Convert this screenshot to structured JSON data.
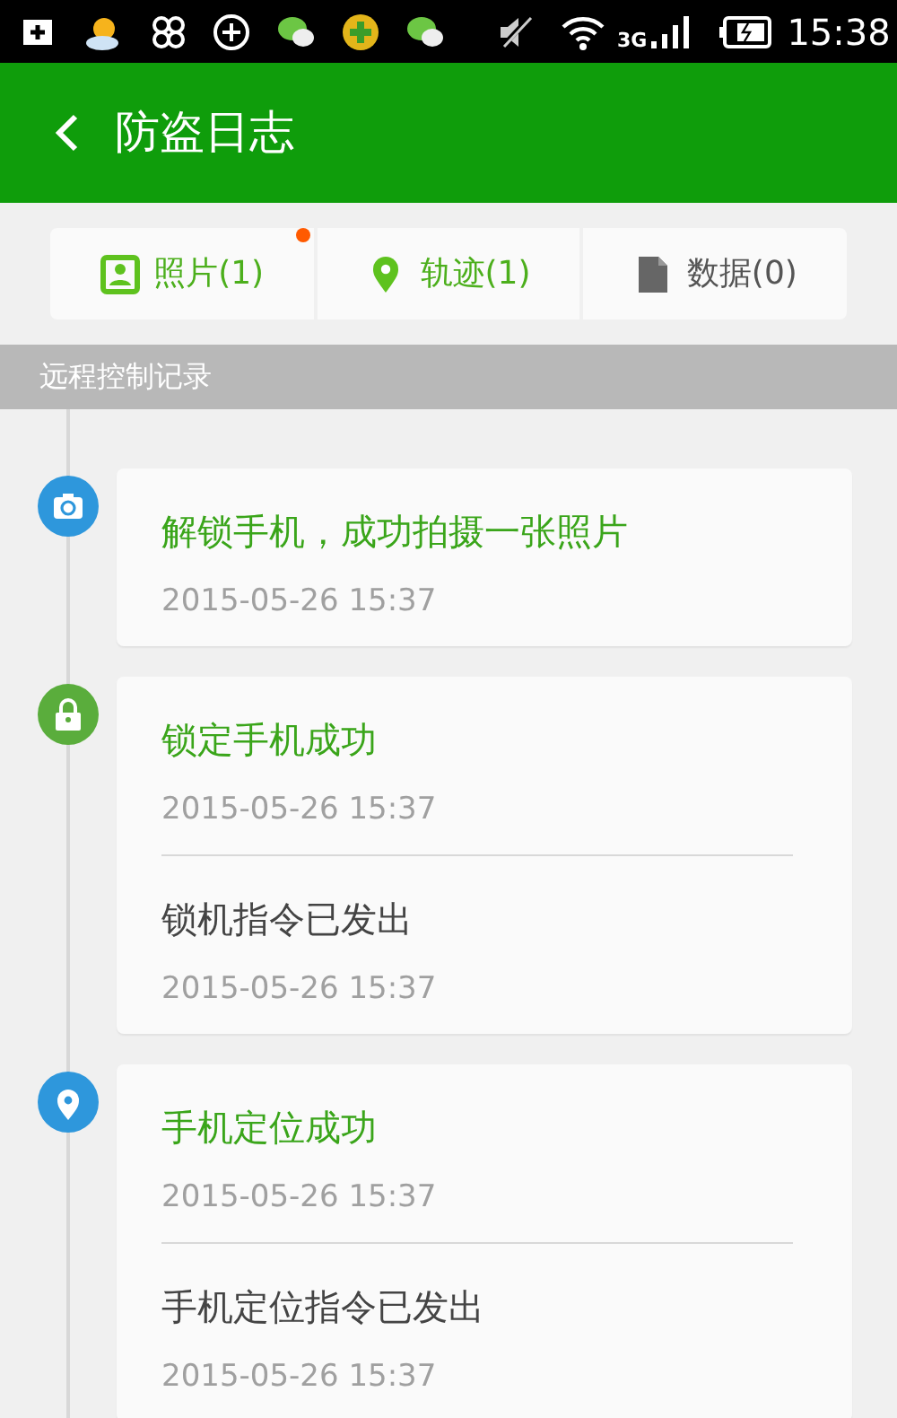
{
  "status_bar": {
    "network": "3G",
    "time": "15:38"
  },
  "header": {
    "title": "防盗日志"
  },
  "tabs": [
    {
      "kind": "photo",
      "label": "照片(1)",
      "highlighted": true,
      "badge": true
    },
    {
      "kind": "track",
      "label": "轨迹(1)",
      "highlighted": true,
      "badge": false
    },
    {
      "kind": "data",
      "label": "数据(0)",
      "highlighted": false,
      "badge": false
    }
  ],
  "section": {
    "title": "远程控制记录"
  },
  "timeline": [
    {
      "kind": "camera",
      "records": [
        {
          "kind": "result",
          "text": "解锁手机，成功拍摄一张照片",
          "time": "2015-05-26 15:37"
        }
      ]
    },
    {
      "kind": "lock",
      "records": [
        {
          "kind": "result",
          "text": "锁定手机成功",
          "time": "2015-05-26 15:37"
        },
        {
          "kind": "command",
          "text": "锁机指令已发出",
          "time": "2015-05-26 15:37"
        }
      ]
    },
    {
      "kind": "location",
      "records": [
        {
          "kind": "result",
          "text": "手机定位成功",
          "time": "2015-05-26 15:37"
        },
        {
          "kind": "command",
          "text": "手机定位指令已发出",
          "time": "2015-05-26 15:37"
        }
      ]
    }
  ]
}
